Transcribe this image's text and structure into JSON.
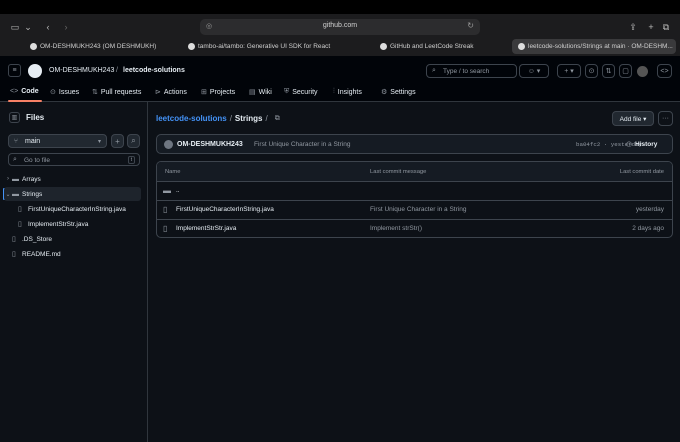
{
  "browser": {
    "url": "github.com",
    "tabs": [
      {
        "label": "OM-DESHMUKH243 (OM DESHMUKH)"
      },
      {
        "label": "tambo-ai/tambo: Generative UI SDK for React"
      },
      {
        "label": "GitHub and LeetCode Streak"
      },
      {
        "label": "leetcode-solutions/Strings at main · OM-DESHM..."
      }
    ]
  },
  "header": {
    "owner": "OM-DESHMUKH243",
    "separator": "/",
    "repo": "leetcode-solutions",
    "search_placeholder": "Type / to search"
  },
  "nav": {
    "items": [
      {
        "label": "Code",
        "icon": "code-icon"
      },
      {
        "label": "Issues",
        "icon": "issue-icon"
      },
      {
        "label": "Pull requests",
        "icon": "pull-request-icon"
      },
      {
        "label": "Actions",
        "icon": "play-icon"
      },
      {
        "label": "Projects",
        "icon": "table-icon"
      },
      {
        "label": "Wiki",
        "icon": "book-icon"
      },
      {
        "label": "Security",
        "icon": "shield-icon"
      },
      {
        "label": "Insights",
        "icon": "graph-icon"
      },
      {
        "label": "Settings",
        "icon": "gear-icon"
      }
    ]
  },
  "sidebar": {
    "title": "Files",
    "branch": "main",
    "goto_placeholder": "Go to file",
    "goto_shortcut": "t",
    "tree": [
      {
        "label": "Arrays",
        "type": "folder",
        "expanded": false
      },
      {
        "label": "Strings",
        "type": "folder",
        "expanded": true,
        "selected": true
      },
      {
        "label": "FirstUniqueCharacterInString.java",
        "type": "file"
      },
      {
        "label": "ImplementStrStr.java",
        "type": "file"
      },
      {
        "label": ".DS_Store",
        "type": "file"
      },
      {
        "label": "README.md",
        "type": "file"
      }
    ]
  },
  "content": {
    "path_repo": "leetcode-solutions",
    "path_sep": "/",
    "path_current": "Strings",
    "path_trailing": "/",
    "add_file": "Add file ▾",
    "commit": {
      "author": "OM-DESHMUKH243",
      "message": "First Unique Character in a String",
      "sha_time": "ba04fc2 · yesterday",
      "history": "History"
    },
    "table": {
      "headers": [
        "Name",
        "Last commit message",
        "Last commit date"
      ],
      "parent": "..",
      "rows": [
        {
          "name": "FirstUniqueCharacterInString.java",
          "message": "First Unique Character in a String",
          "date": "yesterday"
        },
        {
          "name": "ImplementStrStr.java",
          "message": "Implement strStr()",
          "date": "2 days ago"
        }
      ]
    }
  },
  "colors": {
    "accent_link": "#4493f8",
    "nav_underline": "#f78166",
    "background": "#0d1117"
  }
}
